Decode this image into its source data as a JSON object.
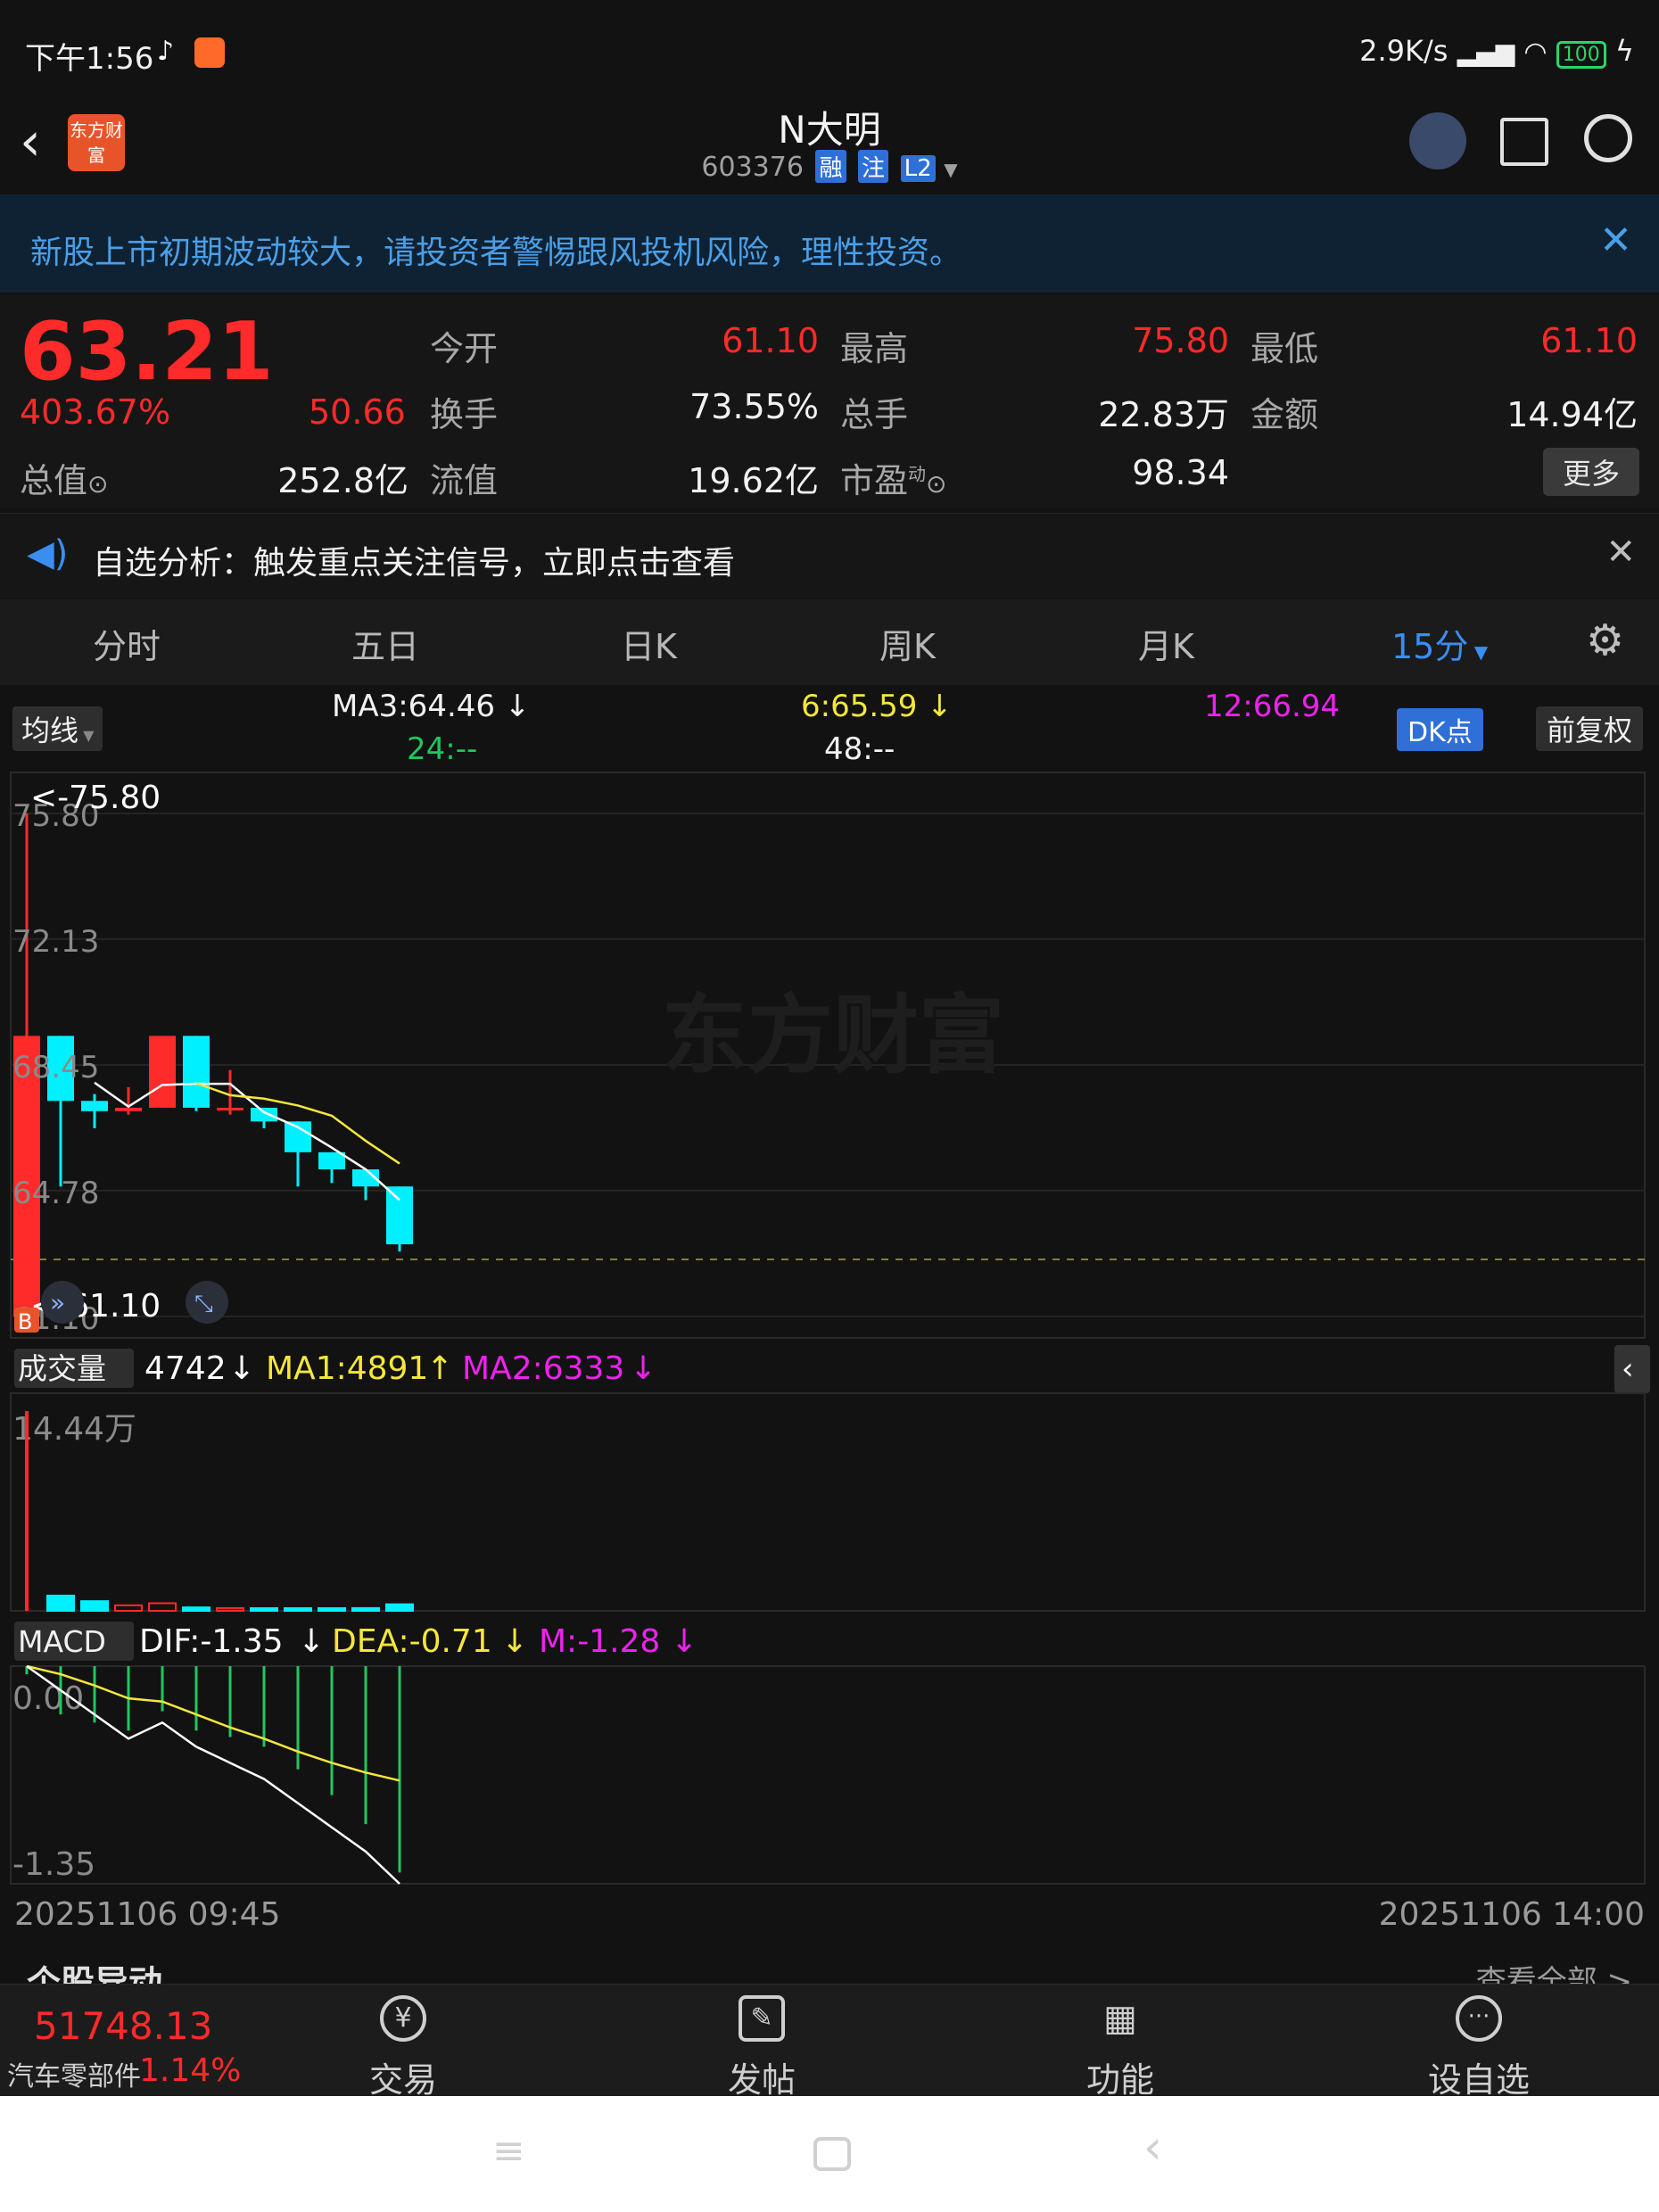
{
  "status_bar": {
    "time": "下午1:56",
    "net_speed": "2.9K/s",
    "battery": "100"
  },
  "header": {
    "logo_text": "东方财富",
    "title": "N大明",
    "code": "603376",
    "tags": [
      "融",
      "注",
      "L2"
    ]
  },
  "notice": {
    "text": "新股上市初期波动较大，请投资者警惕跟风投机风险，理性投资。"
  },
  "quote": {
    "price": "63.21",
    "change_pct": "403.67%",
    "change_amt": "50.66",
    "open_label": "今开",
    "open": "61.10",
    "high_label": "最高",
    "high": "75.80",
    "low_label": "最低",
    "low": "61.10",
    "turnover_label": "换手",
    "turnover": "73.55%",
    "volume_label": "总手",
    "volume": "22.83万",
    "amount_label": "金额",
    "amount": "14.94亿",
    "mcap_label": "总值",
    "mcap": "252.8亿",
    "float_label": "流值",
    "float": "19.62亿",
    "pe_label": "市盈",
    "pe_sup": "动",
    "pe": "98.34",
    "more_label": "更多"
  },
  "signal": {
    "text": "自选分析：触发重点关注信号，立即点击查看"
  },
  "tabs": [
    "分时",
    "五日",
    "日K",
    "周K",
    "月K",
    "15分"
  ],
  "ma_row": {
    "selector": "均线",
    "ma3": "MA3:64.46",
    "ma6": "6:65.59",
    "ma12": "12:66.94",
    "ma24": "24:--",
    "ma48": "48:--",
    "dk_label": "DK点",
    "fq_label": "前复权"
  },
  "price_chart": {
    "y_ticks": [
      "75.80",
      "72.13",
      "68.45",
      "64.78",
      "61.10"
    ],
    "high_marker": "<-75.80",
    "low_marker": "<-61.10",
    "watermark": "东方财富",
    "b_marker": "B"
  },
  "volume_panel": {
    "selector": "成交量",
    "vol": "4742",
    "ma1": "MA1:4891",
    "ma2": "MA2:6333",
    "y_max": "14.44万"
  },
  "macd_panel": {
    "selector": "MACD",
    "dif": "DIF:-1.35",
    "dea": "DEA:-0.71",
    "m": "M:-1.28",
    "y_top": "0.00",
    "y_bottom": "-1.35"
  },
  "time_axis": {
    "start": "20251106 09:45",
    "end": "20251106 14:00"
  },
  "section_peek": {
    "left": "个股异动",
    "right": "查看全部 >"
  },
  "bottom_nav": {
    "index_value": "51748.13",
    "index_name": "汽车零部件",
    "index_change": "1.14%",
    "items": [
      "交易",
      "发帖",
      "功能",
      "设自选"
    ]
  },
  "colors": {
    "up": "#ff2a2a",
    "down": "#00f0ff",
    "ma_white": "#ffffff",
    "ma_yellow": "#f5e63b",
    "ma_magenta": "#ee22ee",
    "notice_bg": "#0f2233",
    "accent_blue": "#2f6fd8"
  },
  "chart_data": {
    "type": "candlestick",
    "interval": "15分",
    "price_range": [
      61.1,
      75.8
    ],
    "candles": [
      {
        "open": 61.1,
        "high": 75.8,
        "low": 61.1,
        "close": 69.3
      },
      {
        "open": 69.3,
        "high": 69.3,
        "low": 64.9,
        "close": 67.4
      },
      {
        "open": 67.4,
        "high": 67.6,
        "low": 66.6,
        "close": 67.1
      },
      {
        "open": 67.1,
        "high": 67.8,
        "low": 67.0,
        "close": 67.2
      },
      {
        "open": 67.2,
        "high": 69.3,
        "low": 67.2,
        "close": 69.3
      },
      {
        "open": 69.3,
        "high": 69.3,
        "low": 67.1,
        "close": 67.2
      },
      {
        "open": 67.2,
        "high": 68.3,
        "low": 67.0,
        "close": 67.2
      },
      {
        "open": 67.2,
        "high": 67.2,
        "low": 66.6,
        "close": 66.8
      },
      {
        "open": 66.8,
        "high": 66.8,
        "low": 64.9,
        "close": 65.9
      },
      {
        "open": 65.9,
        "high": 65.9,
        "low": 65.0,
        "close": 65.4
      },
      {
        "open": 65.4,
        "high": 65.4,
        "low": 64.5,
        "close": 64.9
      },
      {
        "open": 64.9,
        "high": 64.9,
        "low": 63.0,
        "close": 63.21
      }
    ],
    "volume": [
      144400,
      11000,
      7000,
      4000,
      5500,
      2500,
      2000,
      1500,
      1500,
      1500,
      2000,
      4742
    ],
    "macd": {
      "dif": [
        0.0,
        -0.15,
        -0.3,
        -0.45,
        -0.35,
        -0.5,
        -0.6,
        -0.7,
        -0.85,
        -1.0,
        -1.15,
        -1.35
      ],
      "dea": [
        0.0,
        -0.05,
        -0.12,
        -0.2,
        -0.22,
        -0.3,
        -0.38,
        -0.45,
        -0.53,
        -0.6,
        -0.66,
        -0.71
      ],
      "m": [
        -0.05,
        -0.3,
        -0.35,
        -0.4,
        -0.28,
        -0.4,
        -0.44,
        -0.5,
        -0.64,
        -0.8,
        -0.98,
        -1.28
      ]
    }
  }
}
